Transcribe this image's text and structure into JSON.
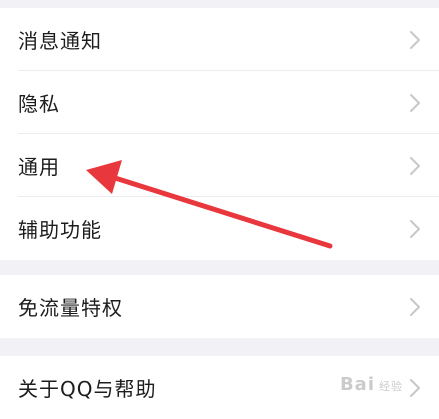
{
  "settings": {
    "groups": [
      {
        "items": [
          {
            "label": "消息通知",
            "icon": "chevron-right"
          },
          {
            "label": "隐私",
            "icon": "chevron-right"
          },
          {
            "label": "通用",
            "icon": "chevron-right"
          },
          {
            "label": "辅助功能",
            "icon": "chevron-right"
          }
        ]
      },
      {
        "items": [
          {
            "label": "免流量特权",
            "icon": "chevron-right"
          }
        ]
      },
      {
        "items": [
          {
            "label": "关于QQ与帮助",
            "icon": "chevron-right"
          }
        ]
      }
    ]
  },
  "annotation": {
    "arrow_color": "#e8383d",
    "target": "通用"
  },
  "watermark": {
    "brand": "Bai",
    "suffix": "经验"
  },
  "colors": {
    "background": "#f2f2f6",
    "row_background": "#ffffff",
    "label_text": "#1d1d1f",
    "chevron": "#c7c7cc"
  }
}
